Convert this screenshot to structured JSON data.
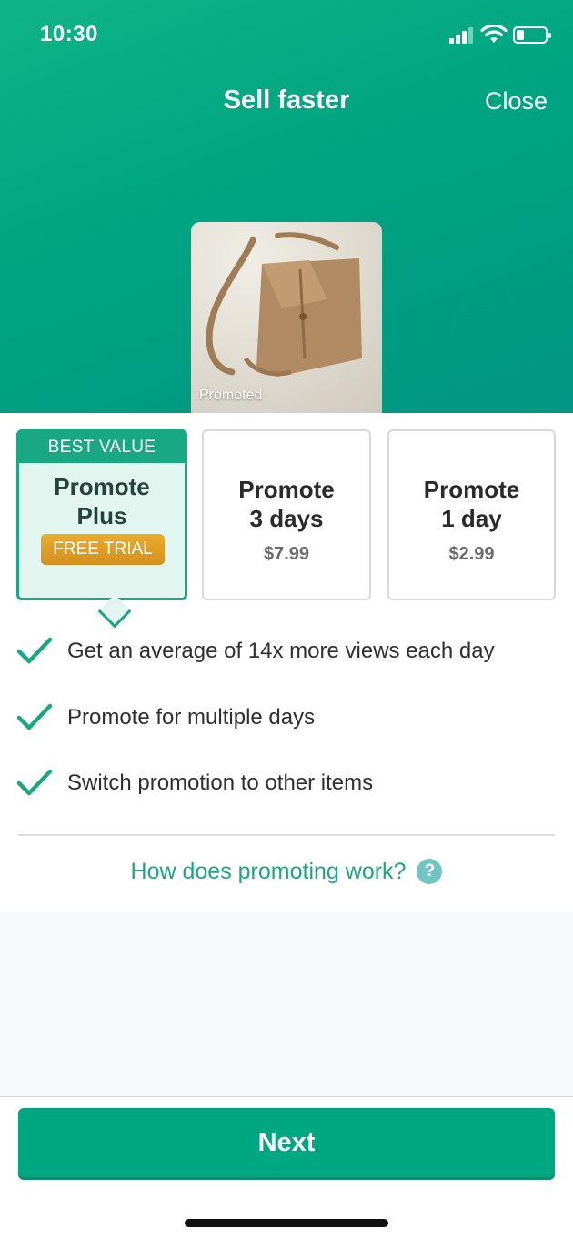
{
  "status": {
    "time": "10:30"
  },
  "header": {
    "title": "Sell faster",
    "close_label": "Close"
  },
  "product": {
    "badge": "Promoted"
  },
  "plans": [
    {
      "badge": "BEST VALUE",
      "name_line1": "Promote",
      "name_line2": "Plus",
      "tag": "FREE TRIAL"
    },
    {
      "name_line1": "Promote",
      "name_line2": "3 days",
      "price": "$7.99"
    },
    {
      "name_line1": "Promote",
      "name_line2": "1 day",
      "price": "$2.99"
    }
  ],
  "benefits": [
    "Get an average of 14x more views each day",
    "Promote for multiple days",
    "Switch promotion to other items"
  ],
  "help": {
    "link": "How does promoting work?",
    "icon": "?"
  },
  "footer": {
    "next_label": "Next"
  },
  "colors": {
    "accent": "#00a882",
    "trial": "#e2a02a",
    "help_icon": "#6fc5c2"
  }
}
